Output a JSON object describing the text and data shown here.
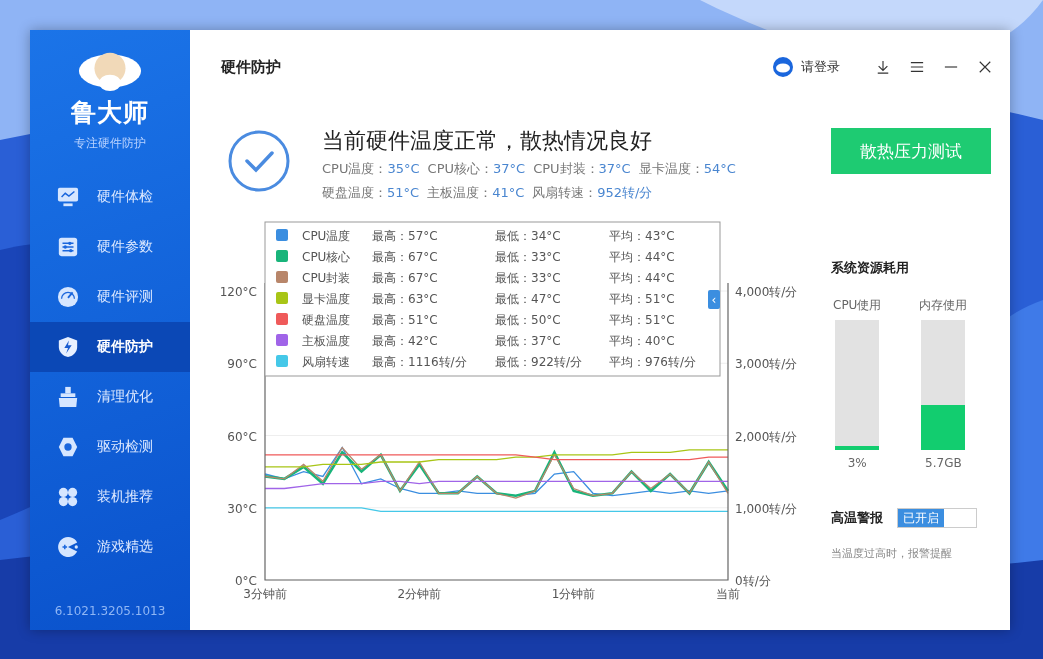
{
  "sidebar": {
    "brand": "鲁大师",
    "tagline": "专注硬件防护",
    "items": [
      {
        "label": "硬件体检",
        "selected": false
      },
      {
        "label": "硬件参数",
        "selected": false
      },
      {
        "label": "硬件评测",
        "selected": false
      },
      {
        "label": "硬件防护",
        "selected": true
      },
      {
        "label": "清理优化",
        "selected": false
      },
      {
        "label": "驱动检测",
        "selected": false
      },
      {
        "label": "装机推荐",
        "selected": false
      },
      {
        "label": "游戏精选",
        "selected": false
      }
    ],
    "version": "6.1021.3205.1013"
  },
  "header": {
    "title": "硬件防护",
    "login": "请登录"
  },
  "status": {
    "title": "当前硬件温度正常，散热情况良好",
    "rows": [
      [
        {
          "label": "CPU温度：",
          "value": "35°C"
        },
        {
          "label": "CPU核心：",
          "value": "37°C"
        },
        {
          "label": "CPU封装：",
          "value": "37°C"
        },
        {
          "label": "显卡温度：",
          "value": "54°C"
        }
      ],
      [
        {
          "label": "硬盘温度：",
          "value": "51°C"
        },
        {
          "label": "主板温度：",
          "value": "41°C"
        },
        {
          "label": "风扇转速：",
          "value": "952转/分"
        }
      ]
    ]
  },
  "stress_button": "散热压力测试",
  "legend": {
    "collapse": "‹",
    "items": [
      {
        "max": "最高：57°C",
        "min": "最低：34°C",
        "avg": "平均：43°C"
      },
      {
        "max": "最高：67°C",
        "min": "最低：33°C",
        "avg": "平均：44°C"
      },
      {
        "max": "最高：67°C",
        "min": "最低：33°C",
        "avg": "平均：44°C"
      },
      {
        "max": "最高：63°C",
        "min": "最低：47°C",
        "avg": "平均：51°C"
      },
      {
        "max": "最高：51°C",
        "min": "最低：50°C",
        "avg": "平均：51°C"
      },
      {
        "max": "最高：42°C",
        "min": "最低：37°C",
        "avg": "平均：40°C"
      },
      {
        "max": "最高：1116转/分",
        "min": "最低：922转/分",
        "avg": "平均：976转/分"
      }
    ]
  },
  "chart_data": {
    "type": "line",
    "grid": true,
    "legend": "top",
    "ylim": [
      0,
      120
    ],
    "y2lim": [
      0,
      4000
    ],
    "categories": [
      "3分钟前",
      null,
      null,
      null,
      null,
      null,
      null,
      null,
      "2分钟前",
      null,
      null,
      null,
      null,
      null,
      null,
      null,
      "1分钟前",
      null,
      null,
      null,
      null,
      null,
      null,
      null,
      "当前"
    ],
    "yticks": [
      {
        "value": 0,
        "label": "0°C"
      },
      {
        "value": 30,
        "label": "30°C"
      },
      {
        "value": 60,
        "label": "60°C"
      },
      {
        "value": 90,
        "label": "90°C"
      },
      {
        "value": 120,
        "label": "120°C"
      }
    ],
    "y2ticks": [
      {
        "value": 0,
        "label": "0转/分"
      },
      {
        "value": 1000,
        "label": "1,000转/分"
      },
      {
        "value": 2000,
        "label": "2,000转/分"
      },
      {
        "value": 3000,
        "label": "3,000转/分"
      },
      {
        "value": 4000,
        "label": "4,000转/分"
      }
    ],
    "series": [
      {
        "name": "CPU温度",
        "color": "#3b8ee0",
        "values": [
          44,
          42,
          45,
          43,
          55,
          40,
          42,
          38,
          36,
          36,
          37,
          36,
          36,
          35,
          36,
          44,
          45,
          36,
          35,
          36,
          37,
          36,
          37,
          36,
          37
        ]
      },
      {
        "name": "CPU核心",
        "color": "#19b47a",
        "values": [
          43,
          42,
          47,
          40,
          53,
          45,
          52,
          37,
          48,
          36,
          36,
          43,
          36,
          35,
          37,
          53,
          37,
          35,
          36,
          45,
          37,
          44,
          36,
          49,
          37
        ]
      },
      {
        "name": "CPU封装",
        "color": "#b8866a",
        "values": [
          43,
          42,
          48,
          41,
          55,
          46,
          52,
          37,
          49,
          36,
          36,
          43,
          36,
          34,
          37,
          52,
          38,
          35,
          36,
          45,
          38,
          44,
          36,
          49,
          36
        ]
      },
      {
        "name": "显卡温度",
        "color": "#a8c516",
        "values": [
          47,
          47,
          47,
          48,
          48,
          48,
          49,
          49,
          49,
          50,
          50,
          50,
          50,
          51,
          51,
          52,
          52,
          52,
          52,
          53,
          53,
          53,
          54,
          54,
          54
        ]
      },
      {
        "name": "硬盘温度",
        "color": "#ef5a5a",
        "values": [
          52,
          52,
          52,
          52,
          52,
          52,
          52,
          52,
          52,
          52,
          52,
          52,
          52,
          52,
          51,
          50,
          50,
          50,
          50,
          50,
          50,
          50,
          50,
          51,
          51
        ]
      },
      {
        "name": "主板温度",
        "color": "#a064e8",
        "values": [
          38,
          38,
          39,
          40,
          40,
          40,
          41,
          41,
          40,
          41,
          41,
          41,
          41,
          41,
          41,
          41,
          41,
          41,
          41,
          41,
          41,
          41,
          41,
          41,
          41
        ]
      },
      {
        "name": "风扇转速",
        "color": "#45c8e8",
        "axis": "y2",
        "values": [
          1000,
          1000,
          1000,
          1000,
          1000,
          1000,
          950,
          950,
          950,
          950,
          950,
          950,
          950,
          950,
          950,
          950,
          950,
          950,
          950,
          950,
          950,
          950,
          950,
          950,
          950
        ]
      }
    ]
  },
  "resources": {
    "title": "系统资源耗用",
    "meters": [
      {
        "label": "CPU使用",
        "level": 0.03,
        "reading": "3%"
      },
      {
        "label": "内存使用",
        "level": 0.35,
        "reading": "5.7GB"
      }
    ]
  },
  "alert": {
    "title": "高温警报",
    "toggle_text": "已开启",
    "on": true,
    "description": "当温度过高时，报警提醒"
  }
}
